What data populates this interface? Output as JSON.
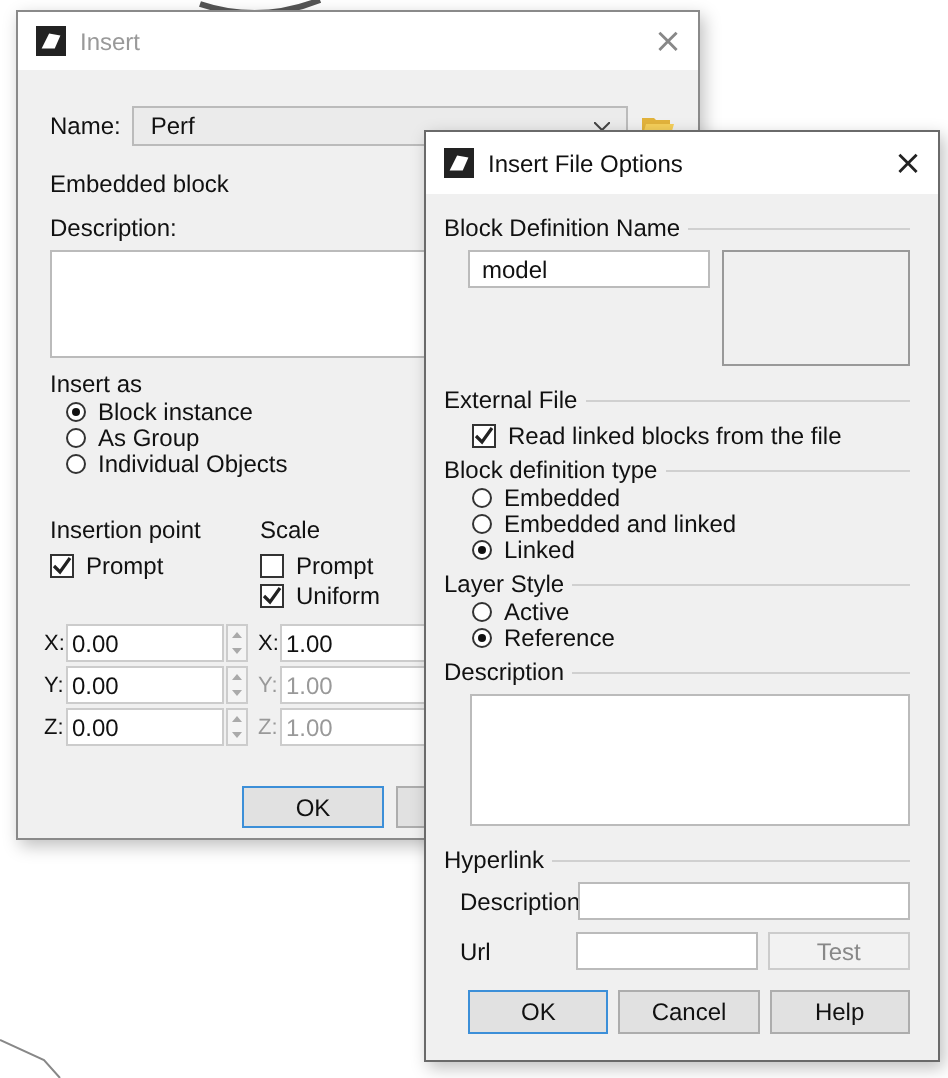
{
  "insert_dialog": {
    "title": "Insert",
    "name_label": "Name:",
    "name_value": "Perf",
    "embedded_label": "Embedded block",
    "description_label": "Description:",
    "insert_as": {
      "label": "Insert as",
      "options": [
        {
          "label": "Block instance",
          "selected": true
        },
        {
          "label": "As Group",
          "selected": false
        },
        {
          "label": "Individual Objects",
          "selected": false
        }
      ]
    },
    "insertion_point": {
      "label": "Insertion point",
      "prompt": {
        "label": "Prompt",
        "checked": true
      }
    },
    "scale": {
      "label": "Scale",
      "prompt": {
        "label": "Prompt",
        "checked": false
      },
      "uniform": {
        "label": "Uniform",
        "checked": true
      }
    },
    "coordinates": [
      {
        "axis": "X:",
        "point": "0.00",
        "scale_axis": "X:",
        "scale": "1.00",
        "scale_disabled": false
      },
      {
        "axis": "Y:",
        "point": "0.00",
        "scale_axis": "Y:",
        "scale": "1.00",
        "scale_disabled": true
      },
      {
        "axis": "Z:",
        "point": "0.00",
        "scale_axis": "Z:",
        "scale": "1.00",
        "scale_disabled": true
      }
    ],
    "ok_button": "OK"
  },
  "options_dialog": {
    "title": "Insert File Options",
    "close": "×",
    "block_definition_name": {
      "label": "Block Definition Name",
      "value": "model"
    },
    "external_file": {
      "label": "External File",
      "read_linked": {
        "label": "Read linked blocks from the file",
        "checked": true
      }
    },
    "block_definition_type": {
      "label": "Block definition type",
      "options": [
        {
          "label": "Embedded",
          "selected": false
        },
        {
          "label": "Embedded and linked",
          "selected": false
        },
        {
          "label": "Linked",
          "selected": true
        }
      ]
    },
    "layer_style": {
      "label": "Layer Style",
      "options": [
        {
          "label": "Active",
          "selected": false
        },
        {
          "label": "Reference",
          "selected": true
        }
      ]
    },
    "description_label": "Description",
    "hyperlink": {
      "label": "Hyperlink",
      "description_label": "Description",
      "url_label": "Url",
      "test_button": "Test",
      "test_disabled": true
    },
    "buttons": [
      "OK",
      "Cancel",
      "Help"
    ]
  },
  "back_close": "×"
}
